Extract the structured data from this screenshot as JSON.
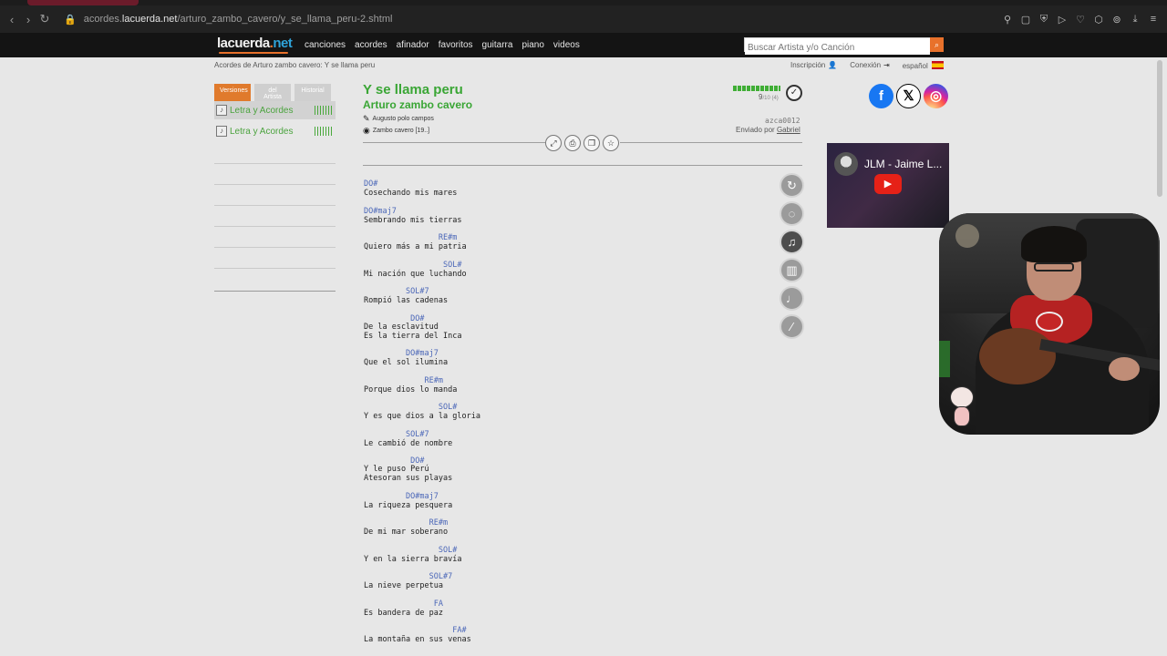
{
  "browser": {
    "url_prefix": "acordes.",
    "url_domain": "lacuerda.net",
    "url_path": "/arturo_zambo_cavero/y_se_llama_peru-2.shtml"
  },
  "site": {
    "logo_main": "lacuerda",
    "logo_dot": ".",
    "logo_net": "net",
    "nav": [
      "canciones",
      "acordes",
      "afinador",
      "favoritos",
      "guitarra",
      "piano",
      "videos"
    ],
    "search_placeholder": "Buscar Artista y/o Canción"
  },
  "breadcrumb": "Acordes de Arturo zambo cavero: Y se llama peru",
  "account": {
    "signup": "Inscripción",
    "login": "Conexión",
    "language": "español"
  },
  "sidebar": {
    "tabs": [
      "Versiones",
      "del Artista",
      "Historial"
    ],
    "versions": [
      "Letra y Acordes",
      "Letra y Acordes"
    ]
  },
  "song": {
    "title": "Y se llama peru",
    "artist": "Arturo zambo cavero",
    "credits": [
      "Augusto polo campos",
      "Zambo cavero [19..]"
    ],
    "rating": "9",
    "rating_detail": "/10 (4)",
    "user_code": "azca0012",
    "sent_by_label": "Enviado por",
    "sent_by_user": "Gabriel"
  },
  "lyrics": [
    {
      "chord": "DO#",
      "text": "Cosechando mis mares"
    },
    {
      "chord": "DO#maj7",
      "text": "Sembrando mis tierras"
    },
    {
      "chord": "                RE#m",
      "text": "Quiero más a mi patria"
    },
    {
      "chord": "                 SOL#",
      "text": "Mi nación que luchando"
    },
    {
      "chord": "         SOL#7",
      "text": "Rompió las cadenas"
    },
    {
      "chord": "          DO#",
      "text": "De la esclavitud",
      "extra": "Es la tierra del Inca"
    },
    {
      "chord": "         DO#maj7",
      "text": "Que el sol ilumina"
    },
    {
      "chord": "             RE#m",
      "text": "Porque dios lo manda"
    },
    {
      "chord": "                SOL#",
      "text": "Y es que dios a la gloria"
    },
    {
      "chord": "         SOL#7",
      "text": "Le cambió de nombre"
    },
    {
      "chord": "          DO#",
      "text": "Y le puso Perú",
      "extra": "Atesoran sus playas"
    },
    {
      "chord": "         DO#maj7",
      "text": "La riqueza pesquera"
    },
    {
      "chord": "              RE#m",
      "text": "De mi mar soberano"
    },
    {
      "chord": "                SOL#",
      "text": "Y en la sierra bravía"
    },
    {
      "chord": "              SOL#7",
      "text": "La nieve perpetua"
    },
    {
      "chord": "               FA",
      "text": "Es bandera de paz"
    },
    {
      "chord": "                   FA#",
      "text": "La montaña en sus venas"
    }
  ],
  "controls": [
    "reset-icon",
    "hide-chords-icon",
    "guitar-icon",
    "piano-icon",
    "ukulele-icon",
    "bass-icon"
  ],
  "video": {
    "title": "JLM - Jaime L..."
  },
  "colors": {
    "accent_green": "#3aa635",
    "accent_orange": "#e07a2c",
    "chord_blue": "#4b67b8"
  }
}
